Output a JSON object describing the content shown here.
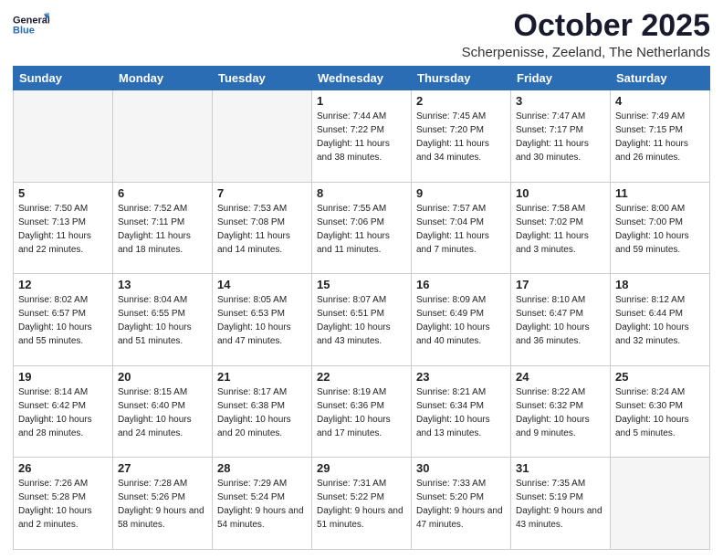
{
  "header": {
    "logo_general": "General",
    "logo_blue": "Blue",
    "month": "October 2025",
    "location": "Scherpenisse, Zeeland, The Netherlands"
  },
  "weekdays": [
    "Sunday",
    "Monday",
    "Tuesday",
    "Wednesday",
    "Thursday",
    "Friday",
    "Saturday"
  ],
  "weeks": [
    [
      {
        "day": "",
        "info": ""
      },
      {
        "day": "",
        "info": ""
      },
      {
        "day": "",
        "info": ""
      },
      {
        "day": "1",
        "info": "Sunrise: 7:44 AM\nSunset: 7:22 PM\nDaylight: 11 hours\nand 38 minutes."
      },
      {
        "day": "2",
        "info": "Sunrise: 7:45 AM\nSunset: 7:20 PM\nDaylight: 11 hours\nand 34 minutes."
      },
      {
        "day": "3",
        "info": "Sunrise: 7:47 AM\nSunset: 7:17 PM\nDaylight: 11 hours\nand 30 minutes."
      },
      {
        "day": "4",
        "info": "Sunrise: 7:49 AM\nSunset: 7:15 PM\nDaylight: 11 hours\nand 26 minutes."
      }
    ],
    [
      {
        "day": "5",
        "info": "Sunrise: 7:50 AM\nSunset: 7:13 PM\nDaylight: 11 hours\nand 22 minutes."
      },
      {
        "day": "6",
        "info": "Sunrise: 7:52 AM\nSunset: 7:11 PM\nDaylight: 11 hours\nand 18 minutes."
      },
      {
        "day": "7",
        "info": "Sunrise: 7:53 AM\nSunset: 7:08 PM\nDaylight: 11 hours\nand 14 minutes."
      },
      {
        "day": "8",
        "info": "Sunrise: 7:55 AM\nSunset: 7:06 PM\nDaylight: 11 hours\nand 11 minutes."
      },
      {
        "day": "9",
        "info": "Sunrise: 7:57 AM\nSunset: 7:04 PM\nDaylight: 11 hours\nand 7 minutes."
      },
      {
        "day": "10",
        "info": "Sunrise: 7:58 AM\nSunset: 7:02 PM\nDaylight: 11 hours\nand 3 minutes."
      },
      {
        "day": "11",
        "info": "Sunrise: 8:00 AM\nSunset: 7:00 PM\nDaylight: 10 hours\nand 59 minutes."
      }
    ],
    [
      {
        "day": "12",
        "info": "Sunrise: 8:02 AM\nSunset: 6:57 PM\nDaylight: 10 hours\nand 55 minutes."
      },
      {
        "day": "13",
        "info": "Sunrise: 8:04 AM\nSunset: 6:55 PM\nDaylight: 10 hours\nand 51 minutes."
      },
      {
        "day": "14",
        "info": "Sunrise: 8:05 AM\nSunset: 6:53 PM\nDaylight: 10 hours\nand 47 minutes."
      },
      {
        "day": "15",
        "info": "Sunrise: 8:07 AM\nSunset: 6:51 PM\nDaylight: 10 hours\nand 43 minutes."
      },
      {
        "day": "16",
        "info": "Sunrise: 8:09 AM\nSunset: 6:49 PM\nDaylight: 10 hours\nand 40 minutes."
      },
      {
        "day": "17",
        "info": "Sunrise: 8:10 AM\nSunset: 6:47 PM\nDaylight: 10 hours\nand 36 minutes."
      },
      {
        "day": "18",
        "info": "Sunrise: 8:12 AM\nSunset: 6:44 PM\nDaylight: 10 hours\nand 32 minutes."
      }
    ],
    [
      {
        "day": "19",
        "info": "Sunrise: 8:14 AM\nSunset: 6:42 PM\nDaylight: 10 hours\nand 28 minutes."
      },
      {
        "day": "20",
        "info": "Sunrise: 8:15 AM\nSunset: 6:40 PM\nDaylight: 10 hours\nand 24 minutes."
      },
      {
        "day": "21",
        "info": "Sunrise: 8:17 AM\nSunset: 6:38 PM\nDaylight: 10 hours\nand 20 minutes."
      },
      {
        "day": "22",
        "info": "Sunrise: 8:19 AM\nSunset: 6:36 PM\nDaylight: 10 hours\nand 17 minutes."
      },
      {
        "day": "23",
        "info": "Sunrise: 8:21 AM\nSunset: 6:34 PM\nDaylight: 10 hours\nand 13 minutes."
      },
      {
        "day": "24",
        "info": "Sunrise: 8:22 AM\nSunset: 6:32 PM\nDaylight: 10 hours\nand 9 minutes."
      },
      {
        "day": "25",
        "info": "Sunrise: 8:24 AM\nSunset: 6:30 PM\nDaylight: 10 hours\nand 5 minutes."
      }
    ],
    [
      {
        "day": "26",
        "info": "Sunrise: 7:26 AM\nSunset: 5:28 PM\nDaylight: 10 hours\nand 2 minutes."
      },
      {
        "day": "27",
        "info": "Sunrise: 7:28 AM\nSunset: 5:26 PM\nDaylight: 9 hours\nand 58 minutes."
      },
      {
        "day": "28",
        "info": "Sunrise: 7:29 AM\nSunset: 5:24 PM\nDaylight: 9 hours\nand 54 minutes."
      },
      {
        "day": "29",
        "info": "Sunrise: 7:31 AM\nSunset: 5:22 PM\nDaylight: 9 hours\nand 51 minutes."
      },
      {
        "day": "30",
        "info": "Sunrise: 7:33 AM\nSunset: 5:20 PM\nDaylight: 9 hours\nand 47 minutes."
      },
      {
        "day": "31",
        "info": "Sunrise: 7:35 AM\nSunset: 5:19 PM\nDaylight: 9 hours\nand 43 minutes."
      },
      {
        "day": "",
        "info": ""
      }
    ]
  ]
}
